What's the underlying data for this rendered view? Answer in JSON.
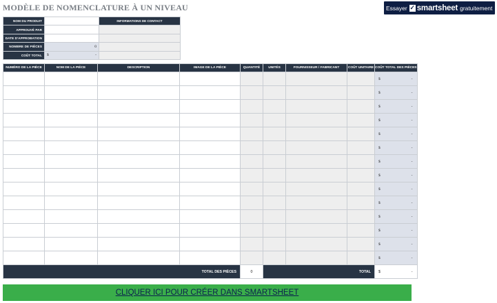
{
  "title": "MODÈLE DE NOMENCLATURE À UN NIVEAU",
  "banner": {
    "try": "Essayer",
    "check": "✓",
    "brand": "smartsheet",
    "free": "gratuitement"
  },
  "info": {
    "product_name_label": "NOM DU PRODUIT",
    "approved_by_label": "APPROUVÉ PAR",
    "approval_date_label": "DATE D'APPROBATION",
    "parts_count_label": "NOMBRE DE PIÈCES",
    "parts_count_value": "0",
    "total_cost_label": "COÛT TOTAL",
    "total_cost_currency": "$",
    "total_cost_value": "-",
    "contact_label": "INFORMATIONS DE CONTACT"
  },
  "table": {
    "headers": [
      "NUMÉRO DE LA PIÈCE",
      "NOM DE LA PIÈCE",
      "DESCRIPTION",
      "IMAGE DE LA PIÈCE",
      "QUANTITÉ",
      "UNITÉS",
      "FOURNISSEUR / FABRICANT",
      "COÛT UNITAIRE",
      "COÛT TOTAL DES PIÈCES"
    ],
    "row_currency": "$",
    "row_value": "-",
    "row_count": 14
  },
  "footer": {
    "parts_total_label": "TOTAL DES PIÈCES",
    "parts_total_value": "0",
    "total_label": "TOTAL",
    "total_currency": "$",
    "total_value": "-"
  },
  "cta": {
    "label": "CLIQUER ICI POUR CRÉER DANS SMARTSHEET"
  }
}
